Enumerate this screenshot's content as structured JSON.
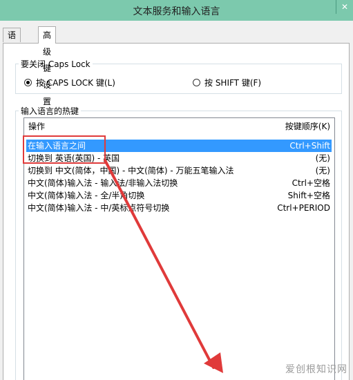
{
  "window": {
    "title": "文本服务和输入语言",
    "close_glyph": "✕"
  },
  "tabs": [
    {
      "label": "语言栏",
      "active": false
    },
    {
      "label": "高级键设置",
      "active": true
    }
  ],
  "caps_lock_group": {
    "title": "要关闭 Caps Lock",
    "options": [
      {
        "label": "按 CAPS LOCK 键(L)",
        "selected": true
      },
      {
        "label": "按 SHIFT 键(F)",
        "selected": false
      }
    ]
  },
  "hotkeys_group": {
    "title": "输入语言的热键",
    "columns": {
      "operation": "操作",
      "key_sequence": "按键顺序(K)"
    },
    "rows": [
      {
        "operation": "在输入语言之间",
        "keys": "Ctrl+Shift",
        "selected": true
      },
      {
        "operation": "切换到 英语(英国) - 英国",
        "keys": "(无)",
        "selected": false
      },
      {
        "operation": "切换到 中文(简体，中国) - 中文(简体) - 万能五笔输入法",
        "keys": "(无)",
        "selected": false
      },
      {
        "operation": "中文(简体)输入法 - 输入法/非输入法切换",
        "keys": "Ctrl+空格",
        "selected": false
      },
      {
        "operation": "中文(简体)输入法 - 全/半角切换",
        "keys": "Shift+空格",
        "selected": false
      },
      {
        "operation": "中文(简体)输入法 - 中/英标点符号切换",
        "keys": "Ctrl+PERIOD",
        "selected": false
      }
    ]
  },
  "annotation": {
    "color": "#e03a3a"
  },
  "watermark": "爱创根知识网",
  "colors": {
    "titlebar": "#7cc9ad",
    "selection": "#3399ff"
  }
}
